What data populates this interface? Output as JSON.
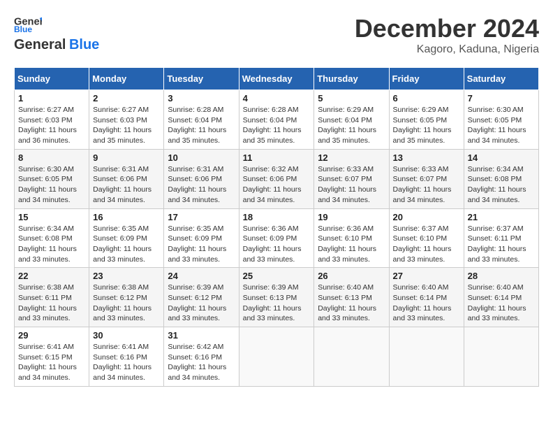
{
  "header": {
    "logo_line1": "General",
    "logo_line2": "Blue",
    "month": "December 2024",
    "location": "Kagoro, Kaduna, Nigeria"
  },
  "days_of_week": [
    "Sunday",
    "Monday",
    "Tuesday",
    "Wednesday",
    "Thursday",
    "Friday",
    "Saturday"
  ],
  "weeks": [
    [
      {
        "day": 1,
        "detail": "Sunrise: 6:27 AM\nSunset: 6:03 PM\nDaylight: 11 hours\nand 36 minutes."
      },
      {
        "day": 2,
        "detail": "Sunrise: 6:27 AM\nSunset: 6:03 PM\nDaylight: 11 hours\nand 35 minutes."
      },
      {
        "day": 3,
        "detail": "Sunrise: 6:28 AM\nSunset: 6:04 PM\nDaylight: 11 hours\nand 35 minutes."
      },
      {
        "day": 4,
        "detail": "Sunrise: 6:28 AM\nSunset: 6:04 PM\nDaylight: 11 hours\nand 35 minutes."
      },
      {
        "day": 5,
        "detail": "Sunrise: 6:29 AM\nSunset: 6:04 PM\nDaylight: 11 hours\nand 35 minutes."
      },
      {
        "day": 6,
        "detail": "Sunrise: 6:29 AM\nSunset: 6:05 PM\nDaylight: 11 hours\nand 35 minutes."
      },
      {
        "day": 7,
        "detail": "Sunrise: 6:30 AM\nSunset: 6:05 PM\nDaylight: 11 hours\nand 34 minutes."
      }
    ],
    [
      {
        "day": 8,
        "detail": "Sunrise: 6:30 AM\nSunset: 6:05 PM\nDaylight: 11 hours\nand 34 minutes."
      },
      {
        "day": 9,
        "detail": "Sunrise: 6:31 AM\nSunset: 6:06 PM\nDaylight: 11 hours\nand 34 minutes."
      },
      {
        "day": 10,
        "detail": "Sunrise: 6:31 AM\nSunset: 6:06 PM\nDaylight: 11 hours\nand 34 minutes."
      },
      {
        "day": 11,
        "detail": "Sunrise: 6:32 AM\nSunset: 6:06 PM\nDaylight: 11 hours\nand 34 minutes."
      },
      {
        "day": 12,
        "detail": "Sunrise: 6:33 AM\nSunset: 6:07 PM\nDaylight: 11 hours\nand 34 minutes."
      },
      {
        "day": 13,
        "detail": "Sunrise: 6:33 AM\nSunset: 6:07 PM\nDaylight: 11 hours\nand 34 minutes."
      },
      {
        "day": 14,
        "detail": "Sunrise: 6:34 AM\nSunset: 6:08 PM\nDaylight: 11 hours\nand 34 minutes."
      }
    ],
    [
      {
        "day": 15,
        "detail": "Sunrise: 6:34 AM\nSunset: 6:08 PM\nDaylight: 11 hours\nand 33 minutes."
      },
      {
        "day": 16,
        "detail": "Sunrise: 6:35 AM\nSunset: 6:09 PM\nDaylight: 11 hours\nand 33 minutes."
      },
      {
        "day": 17,
        "detail": "Sunrise: 6:35 AM\nSunset: 6:09 PM\nDaylight: 11 hours\nand 33 minutes."
      },
      {
        "day": 18,
        "detail": "Sunrise: 6:36 AM\nSunset: 6:09 PM\nDaylight: 11 hours\nand 33 minutes."
      },
      {
        "day": 19,
        "detail": "Sunrise: 6:36 AM\nSunset: 6:10 PM\nDaylight: 11 hours\nand 33 minutes."
      },
      {
        "day": 20,
        "detail": "Sunrise: 6:37 AM\nSunset: 6:10 PM\nDaylight: 11 hours\nand 33 minutes."
      },
      {
        "day": 21,
        "detail": "Sunrise: 6:37 AM\nSunset: 6:11 PM\nDaylight: 11 hours\nand 33 minutes."
      }
    ],
    [
      {
        "day": 22,
        "detail": "Sunrise: 6:38 AM\nSunset: 6:11 PM\nDaylight: 11 hours\nand 33 minutes."
      },
      {
        "day": 23,
        "detail": "Sunrise: 6:38 AM\nSunset: 6:12 PM\nDaylight: 11 hours\nand 33 minutes."
      },
      {
        "day": 24,
        "detail": "Sunrise: 6:39 AM\nSunset: 6:12 PM\nDaylight: 11 hours\nand 33 minutes."
      },
      {
        "day": 25,
        "detail": "Sunrise: 6:39 AM\nSunset: 6:13 PM\nDaylight: 11 hours\nand 33 minutes."
      },
      {
        "day": 26,
        "detail": "Sunrise: 6:40 AM\nSunset: 6:13 PM\nDaylight: 11 hours\nand 33 minutes."
      },
      {
        "day": 27,
        "detail": "Sunrise: 6:40 AM\nSunset: 6:14 PM\nDaylight: 11 hours\nand 33 minutes."
      },
      {
        "day": 28,
        "detail": "Sunrise: 6:40 AM\nSunset: 6:14 PM\nDaylight: 11 hours\nand 33 minutes."
      }
    ],
    [
      {
        "day": 29,
        "detail": "Sunrise: 6:41 AM\nSunset: 6:15 PM\nDaylight: 11 hours\nand 34 minutes."
      },
      {
        "day": 30,
        "detail": "Sunrise: 6:41 AM\nSunset: 6:16 PM\nDaylight: 11 hours\nand 34 minutes."
      },
      {
        "day": 31,
        "detail": "Sunrise: 6:42 AM\nSunset: 6:16 PM\nDaylight: 11 hours\nand 34 minutes."
      },
      null,
      null,
      null,
      null
    ]
  ]
}
